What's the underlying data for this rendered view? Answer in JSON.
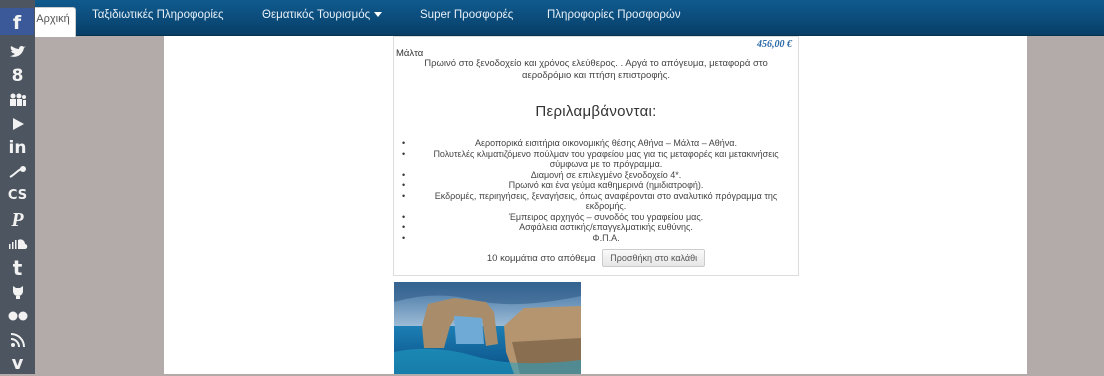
{
  "nav": {
    "home": "Αρχική",
    "items": [
      "Ταξιδιωτικές Πληροφορίες",
      "Θεματικός Τουρισμός",
      "Super Προσφορές",
      "Πληροφορίες Προσφορών"
    ]
  },
  "social_icons": [
    "facebook-icon",
    "twitter-icon",
    "google-plus-icon",
    "myspace-icon",
    "youtube-icon",
    "linkedin-icon",
    "delicious-icon",
    "lastfm-icon",
    "pinterest-icon",
    "soundcloud-icon",
    "tumblr-icon",
    "github-icon",
    "flickr-icon",
    "rss-icon",
    "vimeo-icon"
  ],
  "product": {
    "price": "456,00 €",
    "location": "Μάλτα",
    "description": "Πρωινό στο ξενοδοχείο και χρόνος ελεύθερος. . Αργά το απόγευμα, μεταφορά στο αεροδρόμιο και πτήση επιστροφής.",
    "includes_title": "Περιλαμβάνονται:",
    "includes": [
      "Αεροπορικά εισιτήρια οικονομικής θέσης Αθήνα – Μάλτα – Αθήνα.",
      "Πολυτελές κλιματιζόμενο πούλμαν του γραφείου μας για τις μεταφορές και μετακινήσεις σύμφωνα με το πρόγραμμα.",
      "Διαμονή σε επιλεγμένο ξενοδοχείο 4*.",
      "Πρωινό και ένα γεύμα καθημερινά (ημιδιατροφή).",
      "Εκδρομές, περιηγήσεις, ξεναγήσεις, όπως αναφέρονται στο αναλυτικό πρόγραμμα της εκδρομής.",
      "Έμπειρος αρχηγός – συνοδός του γραφείου μας.",
      "Ασφάλεια αστικής/επαγγελματικής ευθύνης.",
      "Φ.Π.Α."
    ],
    "stock": "10 κομμάτια στο απόθεμα",
    "add_to_cart": "Προσθήκη στο καλάθι"
  },
  "colors": {
    "nav_bg": "#0b4a78",
    "social_bg": "#4d5560",
    "page_bg": "#b3aaaa",
    "price": "#2b69a8"
  }
}
